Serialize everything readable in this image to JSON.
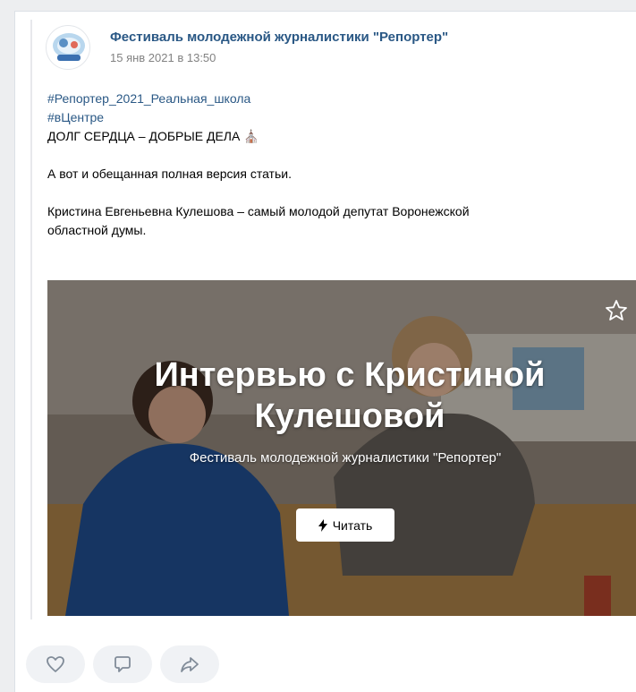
{
  "post": {
    "author": "Фестиваль молодежной журналистики \"Репортер\"",
    "date": "15 янв 2021 в 13:50",
    "hashtags": [
      "#Репортер_2021_Реальная_школа",
      "#вЦентре"
    ],
    "headline": "ДОЛГ СЕРДЦА – ДОБРЫЕ ДЕЛА",
    "paragraph1": "А вот и обещанная полная версия статьи.",
    "paragraph2_line1": "Кристина Евгеньевна Кулешова – самый молодой депутат Воронежской",
    "paragraph2_line2": "областной думы."
  },
  "article": {
    "title_line1": "Интервью с Кристиной",
    "title_line2": "Кулешовой",
    "source": "Фестиваль молодежной журналистики \"Репортер\"",
    "read_label": "Читать",
    "icons": [
      "bolt-icon",
      "star-icon"
    ]
  },
  "actions": {
    "icons": [
      "heart-icon",
      "comment-icon",
      "share-icon"
    ]
  },
  "colors": {
    "link": "#2a5885",
    "date": "#828282",
    "action_bg": "#f0f2f5"
  }
}
